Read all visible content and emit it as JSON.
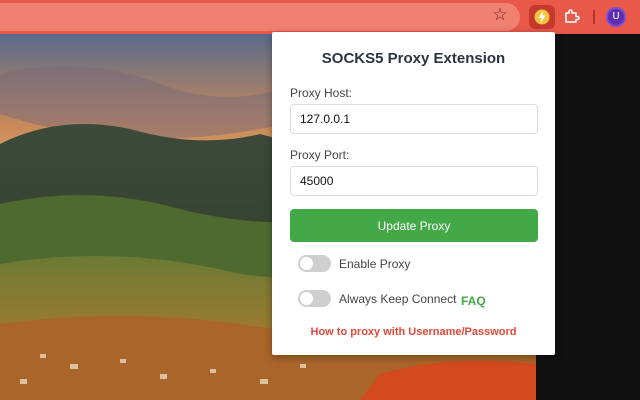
{
  "browser": {
    "bookmark_icon": "star-icon",
    "extension_icon": "lightning-bolt-icon",
    "extensions_menu_icon": "puzzle-icon",
    "profile_initial": "U",
    "toolbar_color": "#e8594a"
  },
  "popup": {
    "title": "SOCKS5 Proxy Extension",
    "host_label": "Proxy Host:",
    "host_value": "127.0.0.1",
    "port_label": "Proxy Port:",
    "port_value": "45000",
    "update_button": "Update Proxy",
    "enable_proxy_label": "Enable Proxy",
    "enable_proxy_on": false,
    "keep_connect_label": "Always Keep Connect",
    "keep_connect_on": false,
    "faq_link": "FAQ",
    "howto_link": "How to proxy with Username/Password",
    "accent_green": "#43a847",
    "accent_red": "#e5473a"
  }
}
